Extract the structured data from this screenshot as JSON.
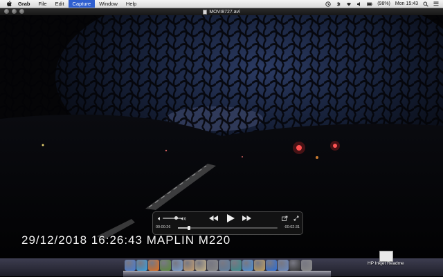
{
  "menubar": {
    "app_name": "Grab",
    "items": [
      {
        "label": "File"
      },
      {
        "label": "Edit"
      },
      {
        "label": "Capture",
        "active": true
      },
      {
        "label": "Window"
      },
      {
        "label": "Help"
      }
    ],
    "status": {
      "battery": "(98%)",
      "clock": "Mon 15:43"
    }
  },
  "window": {
    "title": "MOVI8727.avi"
  },
  "video": {
    "overlay_timestamp": "29/12/2018  16:26:43  MAPLIN  M220"
  },
  "player": {
    "elapsed": "00:00:26",
    "remaining": "-00:02:31",
    "progress_fraction": 0.11,
    "volume_fraction": 0.7
  },
  "desktop": {
    "file_label": "HP Inkjet Readme",
    "dock_icons": [
      "finder-icon",
      "safari-icon",
      "firefox-icon",
      "app-icon",
      "mail-icon",
      "photos-icon",
      "preview-icon",
      "tools-icon",
      "network-icon",
      "itunes-icon",
      "appstore-icon",
      "music-icon",
      "quicktime-icon",
      "time-machine-icon",
      "display-icon",
      "trash-icon"
    ]
  },
  "colors": {
    "menu_active": "#2f5fd0",
    "video_sky": "#1a2540",
    "video_ground": "#050508"
  }
}
